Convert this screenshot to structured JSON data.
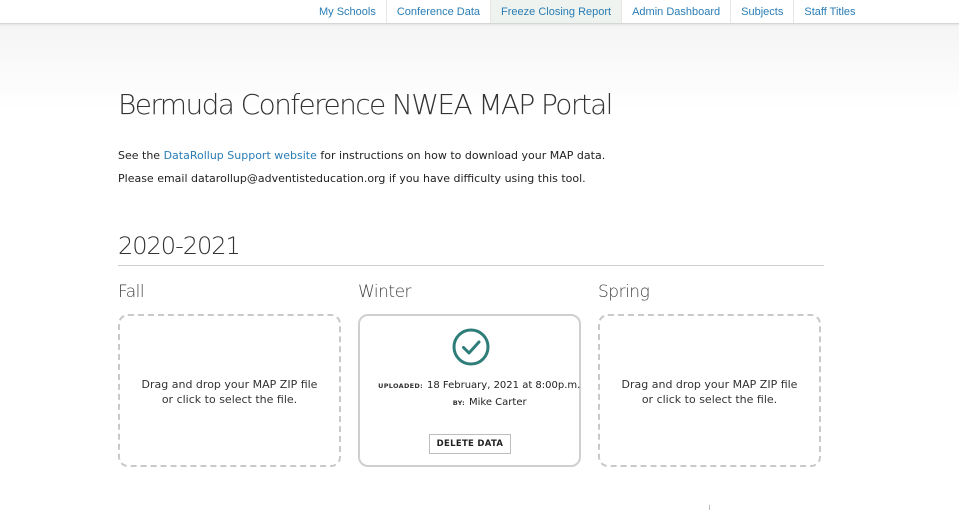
{
  "nav": {
    "items": [
      {
        "label": "My Schools",
        "active": false
      },
      {
        "label": "Conference Data",
        "active": false
      },
      {
        "label": "Freeze Closing Report",
        "active": true
      },
      {
        "label": "Admin Dashboard",
        "active": false
      },
      {
        "label": "Subjects",
        "active": false
      },
      {
        "label": "Staff Titles",
        "active": false
      }
    ]
  },
  "page": {
    "title": "Bermuda Conference NWEA MAP Portal",
    "intro_prefix": "See the ",
    "intro_link": "DataRollup Support website",
    "intro_suffix": " for instructions on how to download your MAP data.",
    "email_line": "Please email datarollup@adventisteducation.org if you have difficulty using this tool."
  },
  "year": {
    "label": "2020-2021",
    "seasons": {
      "fall": {
        "label": "Fall",
        "drop_line1": "Drag and drop your MAP ZIP file",
        "drop_line2": "or click to select the file."
      },
      "winter": {
        "label": "Winter",
        "uploaded_key": "UPLOADED:",
        "uploaded_value": "18 February, 2021 at 8:00p.m.",
        "by_key": "BY:",
        "by_value": "Mike Carter",
        "delete_label": "DELETE DATA"
      },
      "spring": {
        "label": "Spring",
        "drop_line1": "Drag and drop your MAP ZIP file",
        "drop_line2": "or click to select the file."
      }
    }
  },
  "colors": {
    "link": "#2a7db5",
    "check": "#2e7d78",
    "card_border": "#c9c9c9"
  },
  "icons": {
    "upload_complete": "check-circle-icon"
  }
}
